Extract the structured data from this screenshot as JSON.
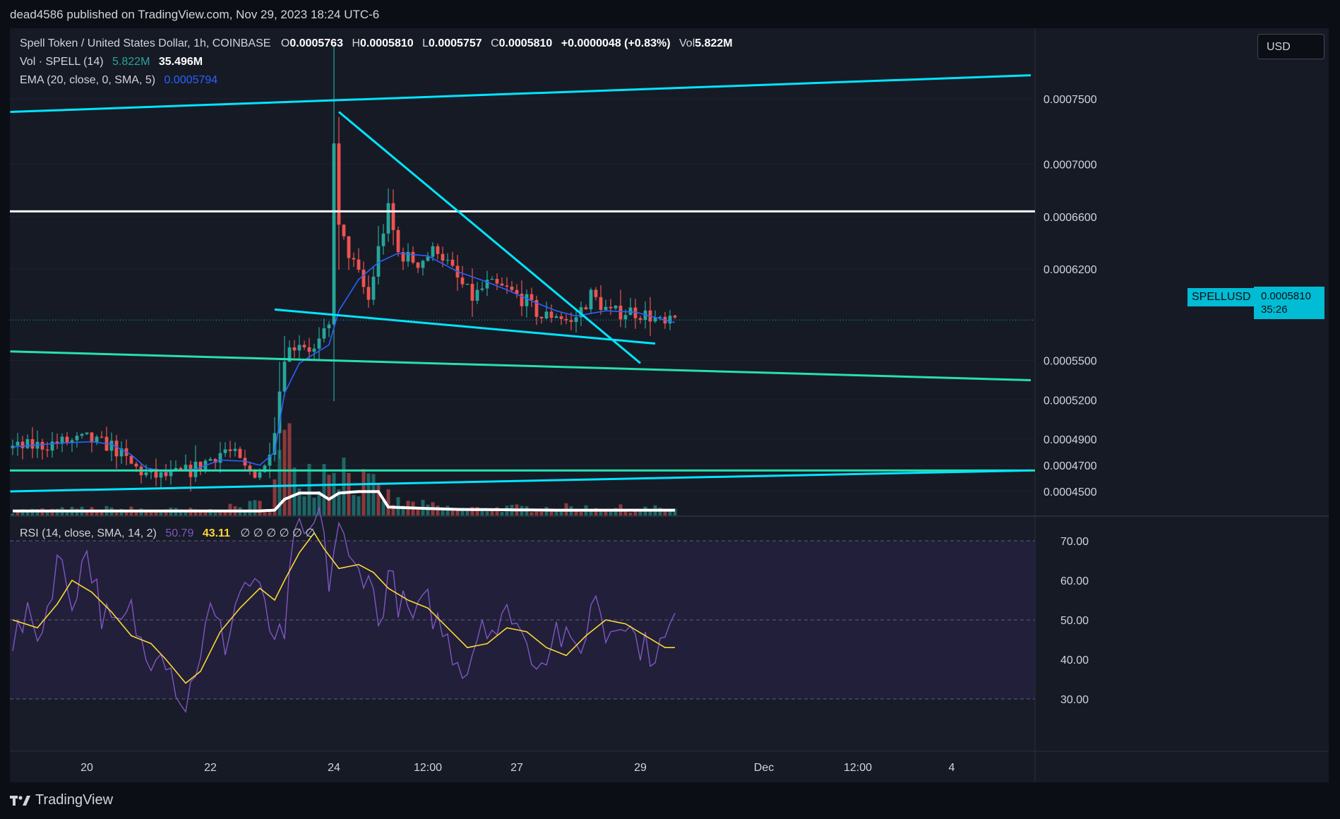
{
  "header": {
    "published": "dead4586 published on TradingView.com, Nov 29, 2023 18:24 UTC-6"
  },
  "legend": {
    "symbol": "Spell Token / United States Dollar, 1h, COINBASE",
    "o_label": "O",
    "o_value": "0.0005763",
    "h_label": "H",
    "h_value": "0.0005810",
    "l_label": "L",
    "l_value": "0.0005757",
    "c_label": "C",
    "c_value": "0.0005810",
    "change": "+0.0000048 (+0.83%)",
    "vol_label": "Vol",
    "vol_value": "5.822M",
    "vol_ind_label": "Vol · SPELL (14)",
    "vol_ind_v1": "5.822M",
    "vol_ind_v2": "35.496M",
    "ema_label": "EMA (20, close, 0, SMA, 5)",
    "ema_value": "0.0005794",
    "rsi_label": "RSI (14, close, SMA, 14, 2)",
    "rsi_value": "50.79",
    "rsi_ma_value": "43.11",
    "rsi_extra": "∅ ∅ ∅ ∅ ∅ ∅"
  },
  "currency_button": "USD",
  "price_badge": {
    "ticker": "SPELLUSD",
    "price": "0.0005810",
    "countdown": "35:26"
  },
  "brand": "TradingView",
  "colors": {
    "bg": "#161a25",
    "up": "#26a69a",
    "down": "#ef5350",
    "ema": "#2962ff",
    "trend": "#00e5ff",
    "support": "#26e0b0",
    "resistance": "#ffffff",
    "rsi": "#7e57c2",
    "rsi_ma": "#fdd835",
    "badge": "#00bcd4"
  },
  "chart_data": [
    {
      "type": "candlestick",
      "x_axis_labels": [
        "20",
        "22",
        "24",
        "12:00",
        "27",
        "29",
        "Dec",
        "12:00",
        "4"
      ],
      "y_axis_labels": [
        "0.0007500",
        "0.0007000",
        "0.0006600",
        "0.0006200",
        "0.0005500",
        "0.0005200",
        "0.0004900",
        "0.0004700",
        "0.0004500"
      ],
      "y_ticks": [
        0.00075,
        0.0007,
        0.00066,
        0.00062,
        0.00055,
        0.00052,
        0.00049,
        0.00047,
        0.00045
      ],
      "price_keypoints": [
        [
          0,
          0.000483
        ],
        [
          5,
          0.000485
        ],
        [
          9,
          0.000487
        ],
        [
          12,
          0.000488
        ],
        [
          15,
          0.00049
        ],
        [
          17,
          0.000487
        ],
        [
          20,
          0.000485
        ],
        [
          24,
          0.00047
        ],
        [
          27,
          0.000463
        ],
        [
          30,
          0.000461
        ],
        [
          33,
          0.000463
        ],
        [
          36,
          0.000466
        ],
        [
          40,
          0.000475
        ],
        [
          43,
          0.000482
        ],
        [
          45,
          0.000477
        ],
        [
          47,
          0.000467
        ],
        [
          49,
          0.000465
        ],
        [
          51,
          0.000468
        ],
        [
          53,
          0.0005
        ],
        [
          55,
          0.000555
        ],
        [
          58,
          0.000565
        ],
        [
          61,
          0.000557
        ],
        [
          64,
          0.000575
        ],
        [
          65,
          0.00072
        ],
        [
          66,
          0.00065
        ],
        [
          68,
          0.000632
        ],
        [
          70,
          0.000615
        ],
        [
          72,
          0.000596
        ],
        [
          74,
          0.000635
        ],
        [
          76,
          0.000665
        ],
        [
          78,
          0.000632
        ],
        [
          82,
          0.000625
        ],
        [
          86,
          0.000636
        ],
        [
          90,
          0.000612
        ],
        [
          93,
          0.000598
        ],
        [
          96,
          0.000608
        ],
        [
          100,
          0.000604
        ],
        [
          104,
          0.000595
        ],
        [
          107,
          0.000583
        ],
        [
          110,
          0.000586
        ],
        [
          113,
          0.000578
        ],
        [
          117,
          0.0006
        ],
        [
          121,
          0.000586
        ],
        [
          125,
          0.000588
        ],
        [
          129,
          0.000584
        ],
        [
          132,
          0.000576
        ],
        [
          134,
          0.000581
        ]
      ],
      "ema_keypoints": [
        [
          0,
          0.000484
        ],
        [
          10,
          0.000487
        ],
        [
          16,
          0.000488
        ],
        [
          20,
          0.000486
        ],
        [
          24,
          0.000478
        ],
        [
          27,
          0.000468
        ],
        [
          31,
          0.000465
        ],
        [
          37,
          0.000467
        ],
        [
          42,
          0.000474
        ],
        [
          47,
          0.000473
        ],
        [
          50,
          0.00047
        ],
        [
          53,
          0.00048
        ],
        [
          55,
          0.000525
        ],
        [
          58,
          0.000548
        ],
        [
          61,
          0.000555
        ],
        [
          64,
          0.000562
        ],
        [
          66,
          0.000588
        ],
        [
          70,
          0.000612
        ],
        [
          74,
          0.000625
        ],
        [
          78,
          0.000632
        ],
        [
          84,
          0.00063
        ],
        [
          90,
          0.000618
        ],
        [
          96,
          0.00061
        ],
        [
          100,
          0.000604
        ],
        [
          106,
          0.000594
        ],
        [
          110,
          0.000588
        ],
        [
          114,
          0.000584
        ],
        [
          120,
          0.000588
        ],
        [
          126,
          0.000587
        ],
        [
          134,
          0.000579
        ]
      ],
      "volume_keypoints": [
        [
          0,
          0.3
        ],
        [
          20,
          0.4
        ],
        [
          40,
          0.3
        ],
        [
          52,
          0.8
        ],
        [
          55,
          4.5
        ],
        [
          58,
          3.2
        ],
        [
          62,
          2.5
        ],
        [
          65,
          4.2
        ],
        [
          67,
          3.0
        ],
        [
          70,
          2.2
        ],
        [
          74,
          1.5
        ],
        [
          78,
          0.8
        ],
        [
          90,
          0.4
        ],
        [
          110,
          0.5
        ],
        [
          134,
          0.4
        ]
      ],
      "volume_ma_keypoints": [
        [
          0,
          0.15
        ],
        [
          50,
          0.15
        ],
        [
          53,
          0.2
        ],
        [
          55,
          0.9
        ],
        [
          58,
          1.3
        ],
        [
          62,
          1.3
        ],
        [
          64,
          0.9
        ],
        [
          66,
          1.3
        ],
        [
          70,
          1.4
        ],
        [
          74,
          1.4
        ],
        [
          76,
          0.4
        ],
        [
          80,
          0.35
        ],
        [
          90,
          0.25
        ],
        [
          110,
          0.2
        ],
        [
          134,
          0.2
        ]
      ],
      "levels": [
        {
          "name": "resistance",
          "price": 0.000664
        },
        {
          "name": "support",
          "price": 0.000466
        }
      ],
      "trendlines": [
        {
          "name": "upper-channel",
          "from": [
            -0.5,
            0.00074
          ],
          "to": [
            206,
            0.000768
          ]
        },
        {
          "name": "lower-channel",
          "from": [
            -0.5,
            0.00045
          ],
          "to": [
            206,
            0.000466
          ]
        },
        {
          "name": "mid-channel",
          "from": [
            -0.5,
            0.000557
          ],
          "to": [
            206,
            0.000535
          ]
        },
        {
          "name": "falling-resistance",
          "from": [
            66,
            0.00074
          ],
          "to": [
            127,
            0.000548
          ]
        },
        {
          "name": "falling-support",
          "from": [
            53,
            0.000589
          ],
          "to": [
            130,
            0.000563
          ]
        }
      ]
    },
    {
      "type": "line",
      "name": "RSI",
      "y_axis_labels": [
        "70.00",
        "60.00",
        "50.00",
        "40.00",
        "30.00"
      ],
      "y_ticks": [
        70,
        60,
        50,
        40,
        30
      ],
      "band": [
        30,
        70
      ],
      "rsi_keypoints": [
        [
          0,
          45
        ],
        [
          3,
          50
        ],
        [
          6,
          47
        ],
        [
          9,
          66
        ],
        [
          12,
          55
        ],
        [
          15,
          68
        ],
        [
          18,
          52
        ],
        [
          21,
          47
        ],
        [
          24,
          52
        ],
        [
          27,
          40
        ],
        [
          30,
          45
        ],
        [
          33,
          34
        ],
        [
          35,
          28
        ],
        [
          37,
          38
        ],
        [
          40,
          52
        ],
        [
          43,
          44
        ],
        [
          46,
          58
        ],
        [
          49,
          60
        ],
        [
          52,
          48
        ],
        [
          55,
          43
        ],
        [
          57,
          75
        ],
        [
          59,
          68
        ],
        [
          62,
          77
        ],
        [
          64,
          60
        ],
        [
          66,
          75
        ],
        [
          68,
          64
        ],
        [
          70,
          62
        ],
        [
          72,
          63
        ],
        [
          74,
          48
        ],
        [
          76,
          62
        ],
        [
          78,
          55
        ],
        [
          81,
          50
        ],
        [
          84,
          54
        ],
        [
          87,
          47
        ],
        [
          90,
          40
        ],
        [
          92,
          38
        ],
        [
          95,
          51
        ],
        [
          98,
          47
        ],
        [
          101,
          53
        ],
        [
          104,
          43
        ],
        [
          107,
          40
        ],
        [
          110,
          48
        ],
        [
          113,
          42
        ],
        [
          116,
          46
        ],
        [
          118,
          58
        ],
        [
          120,
          46
        ],
        [
          123,
          52
        ],
        [
          126,
          45
        ],
        [
          129,
          42
        ],
        [
          132,
          44
        ],
        [
          134,
          51
        ]
      ],
      "rsi_ma_keypoints": [
        [
          0,
          50
        ],
        [
          5,
          48
        ],
        [
          9,
          54
        ],
        [
          12,
          60
        ],
        [
          16,
          57
        ],
        [
          20,
          52
        ],
        [
          24,
          46
        ],
        [
          28,
          44
        ],
        [
          31,
          40
        ],
        [
          35,
          34
        ],
        [
          38,
          37
        ],
        [
          42,
          47
        ],
        [
          46,
          53
        ],
        [
          50,
          58
        ],
        [
          53,
          55
        ],
        [
          55,
          60
        ],
        [
          58,
          67
        ],
        [
          61,
          72
        ],
        [
          63,
          68
        ],
        [
          66,
          63
        ],
        [
          70,
          64
        ],
        [
          73,
          62
        ],
        [
          76,
          58
        ],
        [
          80,
          55
        ],
        [
          84,
          53
        ],
        [
          88,
          48
        ],
        [
          92,
          43
        ],
        [
          96,
          44
        ],
        [
          100,
          48
        ],
        [
          104,
          47
        ],
        [
          108,
          43
        ],
        [
          112,
          41
        ],
        [
          116,
          46
        ],
        [
          120,
          50
        ],
        [
          124,
          49
        ],
        [
          128,
          46
        ],
        [
          132,
          43
        ],
        [
          134,
          43
        ]
      ]
    }
  ]
}
